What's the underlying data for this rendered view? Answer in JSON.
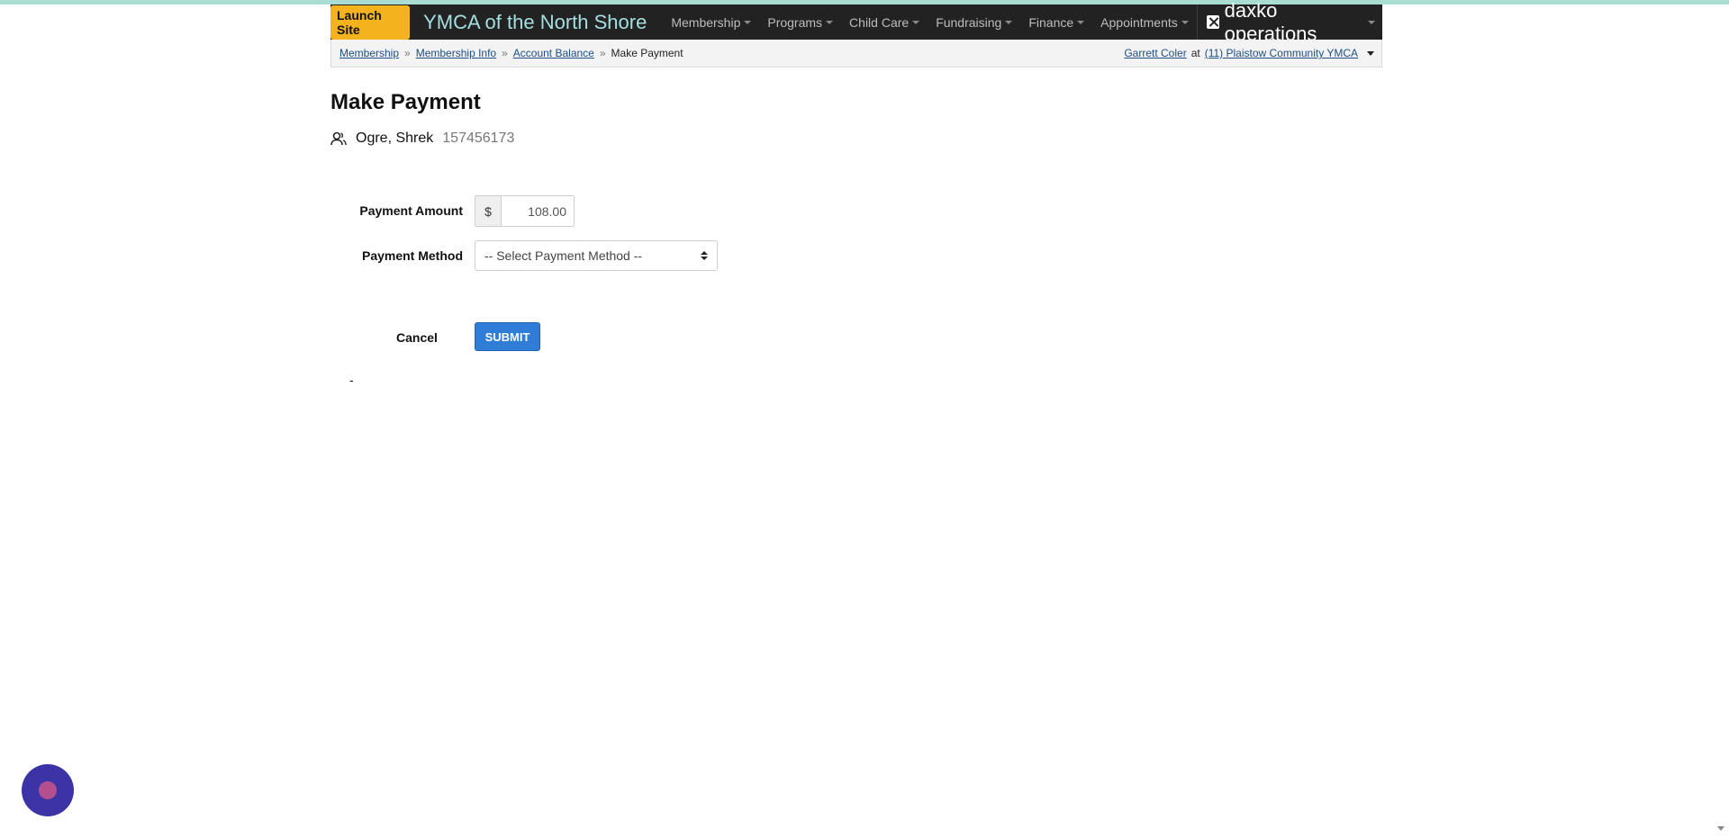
{
  "navbar": {
    "launch_label": "Launch Site",
    "org_title": "YMCA of the North Shore",
    "items": [
      {
        "label": "Membership"
      },
      {
        "label": "Programs"
      },
      {
        "label": "Child Care"
      },
      {
        "label": "Fundraising"
      },
      {
        "label": "Finance"
      },
      {
        "label": "Appointments"
      }
    ],
    "brand_label": "daxko operations",
    "brand_icon": "daxko-logo-icon"
  },
  "breadcrumb": {
    "items": [
      "Membership",
      "Membership Info",
      "Account Balance"
    ],
    "separator": "»",
    "current": "Make Payment"
  },
  "user": {
    "name": "Garrett Coler",
    "at": "at",
    "location": "(11) Plaistow Community YMCA"
  },
  "page": {
    "title": "Make Payment",
    "member_icon": "person-icon",
    "member_name": "Ogre, Shrek",
    "member_id": "157456173"
  },
  "form": {
    "amount_label": "Payment Amount",
    "currency_symbol": "$",
    "amount_value": "108.00",
    "method_label": "Payment Method",
    "method_selected": "-- Select Payment Method --",
    "cancel_label": "Cancel",
    "submit_label": "SUBMIT",
    "stray_text": "-"
  },
  "colors": {
    "accent": "#2f7dd6",
    "launch_badge": "#f4b31e",
    "navbar_bg": "#222222",
    "org_title": "#a6dfe0"
  }
}
